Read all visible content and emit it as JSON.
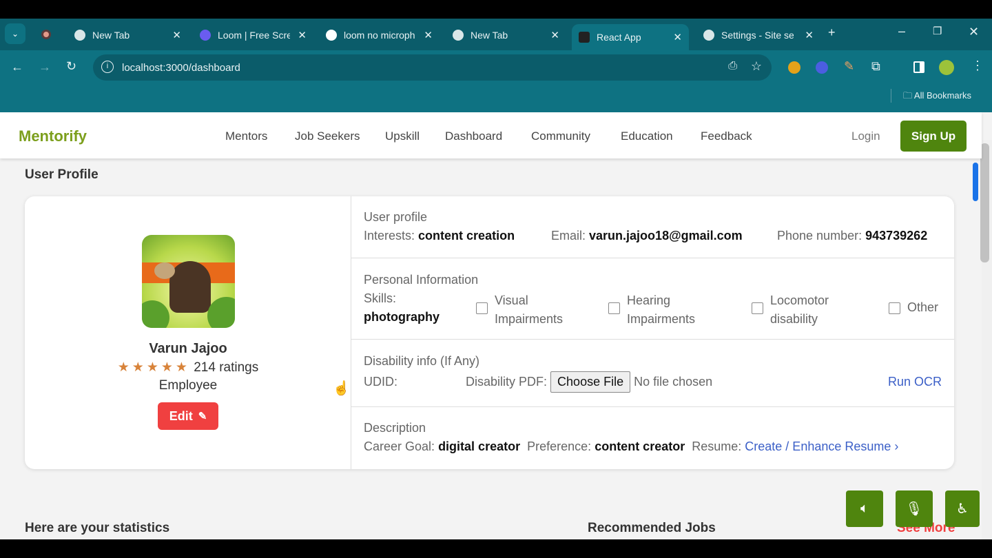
{
  "browser": {
    "tabs": [
      {
        "label": "New Tab"
      },
      {
        "label": "Loom | Free Scree"
      },
      {
        "label": "loom no microph"
      },
      {
        "label": "New Tab"
      },
      {
        "label": "React App",
        "active": true
      },
      {
        "label": "Settings - Site se"
      }
    ],
    "url": "localhost:3000/dashboard",
    "bookmarks_label": "All Bookmarks"
  },
  "nav": {
    "logo": "Mentorify",
    "items": [
      "Mentors",
      "Job Seekers",
      "Upskill",
      "Dashboard",
      "Community",
      "Education",
      "Feedback"
    ],
    "login": "Login",
    "signup": "Sign Up"
  },
  "profile": {
    "heading": "User Profile",
    "name": "Varun Jajoo",
    "stars": 5,
    "ratings": "214 ratings",
    "role": "Employee",
    "edit": "Edit",
    "user_section": {
      "title": "User profile",
      "interests_label": "Interests:",
      "interests": "content creation",
      "email_label": "Email:",
      "email": "varun.jajoo18@gmail.com",
      "phone_label": "Phone number:",
      "phone": "943739262"
    },
    "personal": {
      "title": "Personal Information",
      "skills_label": "Skills:",
      "skills": "photography",
      "checkboxes": [
        "Visual Impairments",
        "Hearing Impairments",
        "Locomotor disability",
        "Other"
      ]
    },
    "disability": {
      "title": "Disability info (If Any)",
      "udid_label": "UDID:",
      "pdf_label": "Disability PDF:",
      "choose": "Choose File",
      "no_file": "No file chosen",
      "ocr": "Run OCR"
    },
    "description": {
      "title": "Description",
      "goal_label": "Career Goal:",
      "goal": "digital creator",
      "pref_label": "Preference:",
      "pref": "content creator",
      "resume_label": "Resume:",
      "resume_link": "Create / Enhance Resume ›"
    }
  },
  "stats_heading": "Here are your statistics",
  "jobs_heading": "Recommended Jobs",
  "see_more": "See More",
  "colors": {
    "accent": "#4f850e",
    "danger": "#f04040",
    "link": "#3b5fc7"
  }
}
